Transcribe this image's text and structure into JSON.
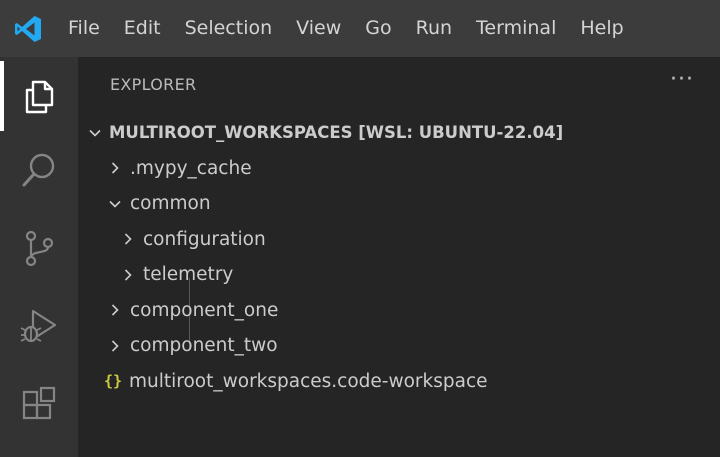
{
  "colors": {
    "titlebar": "#3c3c3c",
    "activitybar": "#333333",
    "sidebar": "#252526",
    "text": "#cccccc",
    "logo": "#23a9f2",
    "json_icon": "#cbcb41"
  },
  "menu": {
    "items": [
      "File",
      "Edit",
      "Selection",
      "View",
      "Go",
      "Run",
      "Terminal",
      "Help"
    ]
  },
  "activity": {
    "items": [
      "explorer-icon",
      "search-icon",
      "source-control-icon",
      "run-debug-icon",
      "extensions-icon"
    ],
    "active": "explorer-icon"
  },
  "explorer": {
    "title": "EXPLORER",
    "more": "···",
    "workspace": "MULTIROOT_WORKSPACES [WSL: UBUNTU-22.04]",
    "tree": [
      {
        "label": ".mypy_cache",
        "expanded": false
      },
      {
        "label": "common",
        "expanded": true
      },
      {
        "label": "configuration",
        "expanded": false
      },
      {
        "label": "telemetry",
        "expanded": false
      },
      {
        "label": "component_one",
        "expanded": false
      },
      {
        "label": "component_two",
        "expanded": false
      },
      {
        "label": "multiroot_workspaces.code-workspace",
        "icon_glyph": "{}"
      }
    ]
  }
}
